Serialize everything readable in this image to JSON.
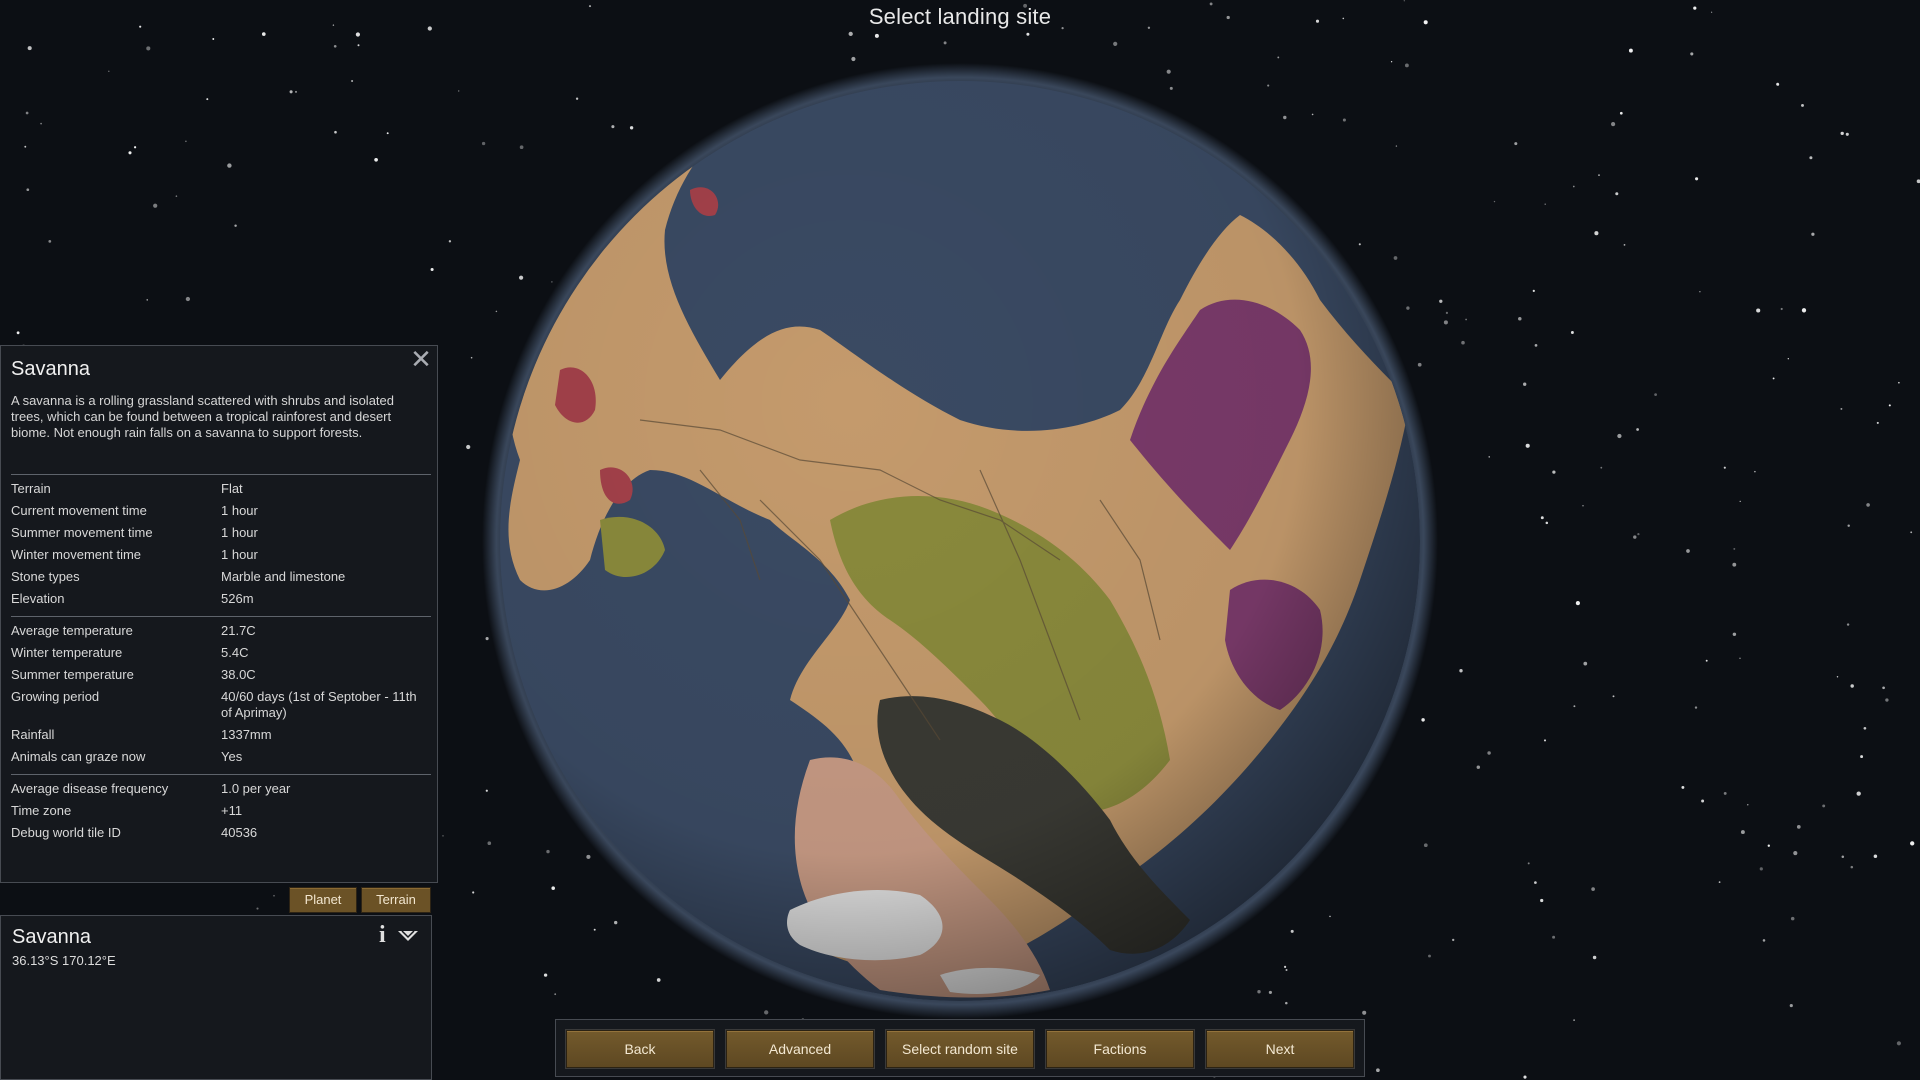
{
  "screen": {
    "title": "Select landing site"
  },
  "inspect": {
    "title": "Savanna",
    "description": "A savanna is a rolling grassland scattered with shrubs and isolated trees, which can be found between a tropical rainforest and desert biome. Not enough rain falls on a savanna to support forests.",
    "close_icon": "close-icon",
    "groups": [
      [
        {
          "label": "Terrain",
          "value": "Flat"
        },
        {
          "label": "Current movement time",
          "value": "1 hour"
        },
        {
          "label": "Summer movement time",
          "value": "1 hour"
        },
        {
          "label": "Winter movement time",
          "value": "1 hour"
        },
        {
          "label": "Stone types",
          "value": "Marble and limestone"
        },
        {
          "label": "Elevation",
          "value": "526m"
        }
      ],
      [
        {
          "label": "Average temperature",
          "value": "21.7C"
        },
        {
          "label": "Winter temperature",
          "value": "5.4C"
        },
        {
          "label": "Summer temperature",
          "value": "38.0C"
        },
        {
          "label": "Growing period",
          "value": "40/60 days (1st of Septober - 11th of Aprimay)"
        },
        {
          "label": "Rainfall",
          "value": "1337mm"
        },
        {
          "label": "Animals can graze now",
          "value": "Yes"
        }
      ],
      [
        {
          "label": "Average disease frequency",
          "value": "1.0 per year"
        },
        {
          "label": "Time zone",
          "value": "+11"
        },
        {
          "label": "Debug world tile ID",
          "value": "40536"
        }
      ]
    ]
  },
  "tabs": {
    "planet": "Planet",
    "terrain": "Terrain"
  },
  "location": {
    "title": "Savanna",
    "coords": "36.13°S 170.12°E",
    "info_icon": "info-icon",
    "expand_icon": "chevron-down-icon"
  },
  "nav": {
    "back": "Back",
    "advanced": "Advanced",
    "random": "Select random site",
    "factions": "Factions",
    "next": "Next"
  },
  "colors": {
    "ocean": "#3a4a63",
    "savanna": "#c49a6c",
    "desert": "#c9a37d",
    "grassland": "#8a8a3c",
    "jungle": "#7a3a6a",
    "mountain_red": "#a3414a",
    "wasteland": "#3a3a34",
    "ice": "#e6e6e6",
    "button": "#6b5226"
  }
}
